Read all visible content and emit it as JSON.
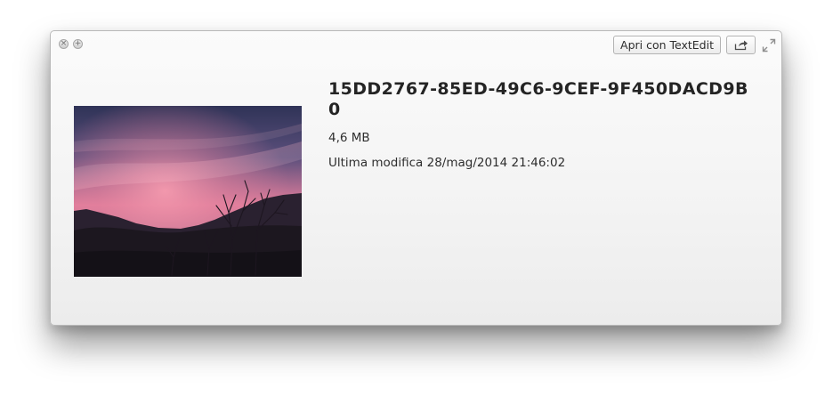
{
  "window": {
    "close_glyph": "×",
    "zoom_glyph": "+",
    "open_with_label": "Apri con TextEdit",
    "share_icon": "share-icon",
    "expand_icon": "fullscreen-icon"
  },
  "preview": {
    "thumbnail": "sunset-landscape-thumbnail",
    "thumbnail_colors": {
      "sky_top": "#2f3357",
      "sky_glow": "#f08aa3",
      "ground": "#15131a"
    }
  },
  "file": {
    "name": "15DD2767-85ED-49C6-9CEF-9F450DACD9B0",
    "size": "4,6 MB",
    "modified": "Ultima modifica 28/mag/2014 21:46:02"
  }
}
